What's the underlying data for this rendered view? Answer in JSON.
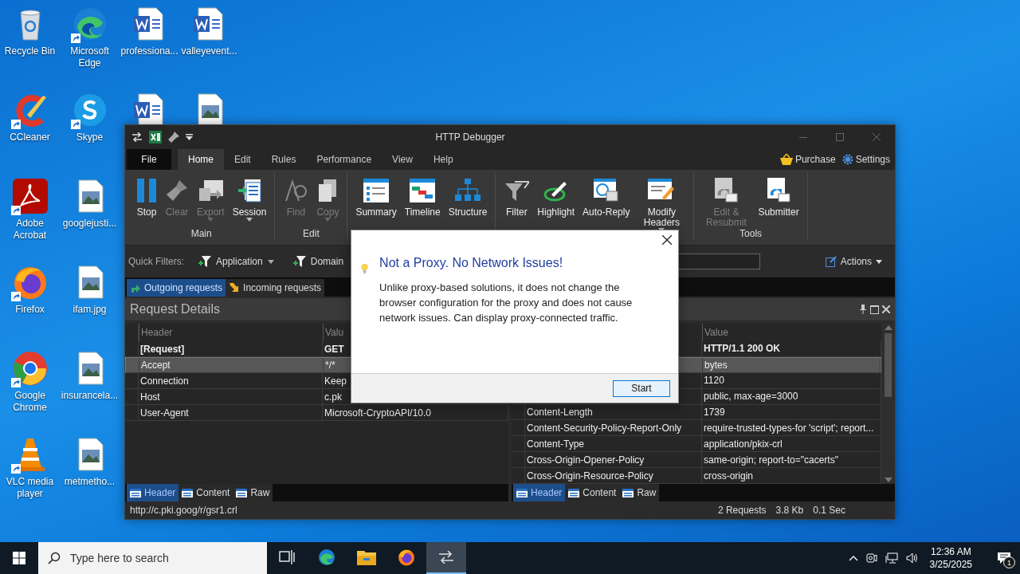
{
  "desktop": {
    "columns": [
      [
        {
          "label": "Recycle Bin",
          "kind": "bin",
          "shortcut": false
        },
        {
          "label": "CCleaner",
          "kind": "ccleaner",
          "shortcut": true
        },
        {
          "label": "Adobe Acrobat",
          "kind": "acrobat",
          "shortcut": true
        },
        {
          "label": "Firefox",
          "kind": "firefox",
          "shortcut": true
        },
        {
          "label": "Google Chrome",
          "kind": "chrome",
          "shortcut": true
        },
        {
          "label": "VLC media player",
          "kind": "vlc",
          "shortcut": true
        }
      ],
      [
        {
          "label": "Microsoft Edge",
          "kind": "edge",
          "shortcut": true
        },
        {
          "label": "Skype",
          "kind": "skype",
          "shortcut": true
        },
        {
          "label": "googlejusti...",
          "kind": "image",
          "shortcut": false
        },
        {
          "label": "ifam.jpg",
          "kind": "image",
          "shortcut": false
        },
        {
          "label": "insurancela...",
          "kind": "image",
          "shortcut": false
        },
        {
          "label": "metmetho...",
          "kind": "image",
          "shortcut": false
        }
      ],
      [
        {
          "label": "professiona...",
          "kind": "word",
          "shortcut": false
        },
        {
          "kind": "word",
          "shortcut": false
        }
      ],
      [
        {
          "label": "valleyevent...",
          "kind": "word",
          "shortcut": false
        },
        {
          "kind": "image",
          "shortcut": false
        }
      ]
    ]
  },
  "window": {
    "title": "HTTP Debugger",
    "file": "File",
    "tabs": [
      {
        "label": "Home",
        "selected": true
      },
      {
        "label": "Edit",
        "selected": false
      },
      {
        "label": "Rules",
        "selected": false
      },
      {
        "label": "Performance",
        "selected": false
      },
      {
        "label": "View",
        "selected": false
      },
      {
        "label": "Help",
        "selected": false
      }
    ],
    "links": [
      "Purchase",
      "Settings"
    ],
    "ribbon": {
      "groups": [
        {
          "label": "Main",
          "buttons": [
            {
              "label": "Stop",
              "disabled": false,
              "dropdown": false
            },
            {
              "label": "Clear",
              "disabled": true,
              "dropdown": false
            },
            {
              "label": "Export",
              "disabled": true,
              "dropdown": true
            },
            {
              "label": "Session",
              "disabled": false,
              "dropdown": true
            }
          ]
        },
        {
          "label": "Edit",
          "buttons": [
            {
              "label": "Find",
              "disabled": true,
              "dropdown": false
            },
            {
              "label": "Copy",
              "disabled": true,
              "dropdown": true
            }
          ]
        },
        {
          "buttons": [
            {
              "label": "Summary",
              "disabled": false,
              "dropdown": false
            },
            {
              "label": "Timeline",
              "disabled": false,
              "dropdown": false
            },
            {
              "label": "Structure",
              "disabled": false,
              "dropdown": false
            }
          ]
        },
        {
          "buttons": [
            {
              "label": "Filter",
              "disabled": false,
              "dropdown": false
            },
            {
              "label": "Highlight",
              "disabled": false,
              "dropdown": false
            },
            {
              "label": "Auto-Reply",
              "disabled": false,
              "dropdown": false
            },
            {
              "label": "Modify Headers",
              "disabled": false,
              "dropdown": true
            }
          ]
        },
        {
          "label": "Tools",
          "buttons": [
            {
              "label": "Edit & Resubmit",
              "disabled": true,
              "dropdown": false
            },
            {
              "label": "Submitter",
              "disabled": false,
              "dropdown": false
            }
          ]
        }
      ]
    },
    "quick_filters": {
      "label": "Quick Filters:",
      "filters": [
        {
          "label": "Application",
          "dropdown": true
        },
        {
          "label": "Domain",
          "dropdown": false
        }
      ],
      "actions": "Actions"
    },
    "request_tabs": [
      {
        "label": "Outgoing requests",
        "selected": true
      },
      {
        "label": "Incoming requests",
        "selected": false
      }
    ],
    "details": {
      "title": "Request Details",
      "request": {
        "header_heading": "Header",
        "value_heading": "Valu",
        "rows": [
          {
            "header": "[Request]",
            "value": "GET",
            "bold": true,
            "selected": false
          },
          {
            "header": "Accept",
            "value": "*/*",
            "bold": false,
            "selected": true
          },
          {
            "header": "Connection",
            "value": "Keep",
            "bold": false,
            "selected": false
          },
          {
            "header": "Host",
            "value": "c.pk",
            "bold": false,
            "selected": false
          },
          {
            "header": "User-Agent",
            "value": "Microsoft-CryptoAPI/10.0",
            "bold": false,
            "selected": false
          }
        ],
        "tabs": [
          {
            "label": "Header",
            "selected": true
          },
          {
            "label": "Content",
            "selected": false
          },
          {
            "label": "Raw",
            "selected": false
          }
        ]
      },
      "response": {
        "value_heading": "Value",
        "rows": [
          {
            "value": "HTTP/1.1 200 OK",
            "bold": true,
            "selected": false
          },
          {
            "value": "bytes",
            "bold": false,
            "selected": true
          },
          {
            "value": "1120",
            "bold": false,
            "selected": false
          },
          {
            "value": "public, max-age=3000",
            "bold": false,
            "selected": false
          },
          {
            "header": "Content-Length",
            "value": "1739",
            "bold": false,
            "selected": false
          },
          {
            "header": "Content-Security-Policy-Report-Only",
            "value": "require-trusted-types-for 'script'; report...",
            "bold": false,
            "selected": false
          },
          {
            "header": "Content-Type",
            "value": "application/pkix-crl",
            "bold": false,
            "selected": false
          },
          {
            "header": "Cross-Origin-Opener-Policy",
            "value": "same-origin; report-to=\"cacerts\"",
            "bold": false,
            "selected": false
          },
          {
            "header": "Cross-Origin-Resource-Policy",
            "value": "cross-origin",
            "bold": false,
            "selected": false
          }
        ],
        "tabs": [
          {
            "label": "Header",
            "selected": true
          },
          {
            "label": "Content",
            "selected": false
          },
          {
            "label": "Raw",
            "selected": false
          }
        ]
      }
    },
    "status": {
      "url": "http://c.pki.goog/r/gsr1.crl",
      "requests": "2 Requests",
      "size": "3.8 Kb",
      "time": "0.1 Sec"
    }
  },
  "dialog": {
    "title": "Not a Proxy. No Network Issues!",
    "body": "Unlike proxy-based solutions, it does not change the browser configuration for the proxy and does not cause network issues. Can display proxy-connected traffic.",
    "button": "Start"
  },
  "taskbar": {
    "search_placeholder": "Type here to search",
    "apps": [
      {
        "kind": "taskview",
        "active": false
      },
      {
        "kind": "edge",
        "active": false
      },
      {
        "kind": "explorer",
        "active": false
      },
      {
        "kind": "firefox",
        "active": false
      },
      {
        "kind": "debugger",
        "active": true
      }
    ],
    "time": "12:36 AM",
    "date": "3/25/2025",
    "notifications": "1"
  }
}
